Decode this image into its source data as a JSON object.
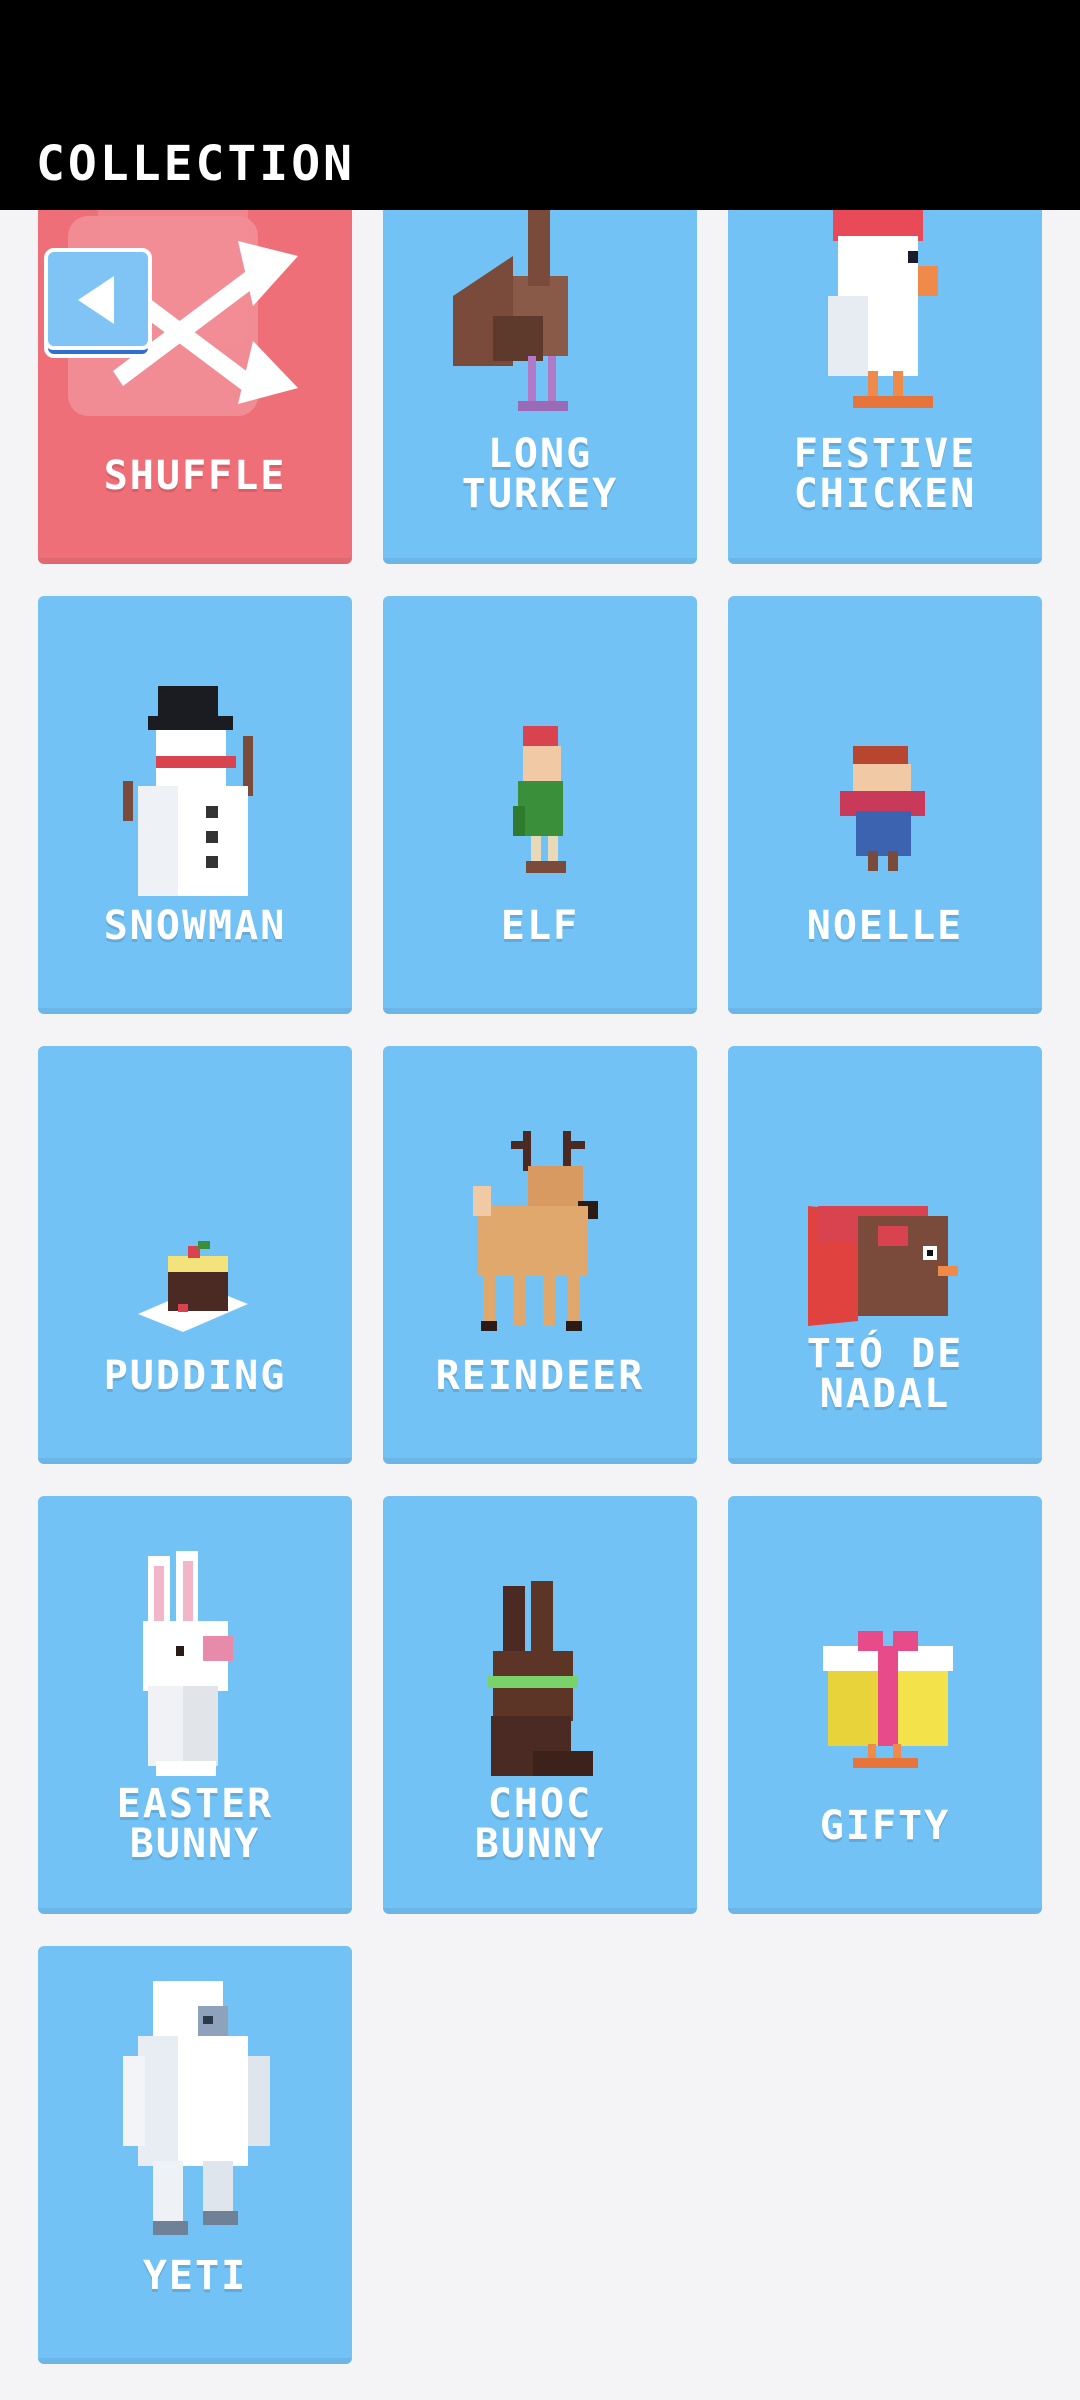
{
  "header": {
    "title": "COLLECTION"
  },
  "back_button": {
    "icon": "back-arrow-icon"
  },
  "colors": {
    "header_bg": "#000000",
    "card_blue": "#72c2f5",
    "card_shuffle": "#ef6f78",
    "page_bg": "#f4f4f6"
  },
  "cards": [
    {
      "label": "SHUFFLE",
      "icon": "shuffle-icon"
    },
    {
      "label": "LONG\nTURKEY",
      "icon": "turkey-icon"
    },
    {
      "label": "FESTIVE\nCHICKEN",
      "icon": "chicken-icon"
    },
    {
      "label": "SNOWMAN",
      "icon": "snowman-icon"
    },
    {
      "label": "ELF",
      "icon": "elf-icon"
    },
    {
      "label": "NOELLE",
      "icon": "noelle-icon"
    },
    {
      "label": "PUDDING",
      "icon": "pudding-icon"
    },
    {
      "label": "REINDEER",
      "icon": "reindeer-icon"
    },
    {
      "label": "TIÓ DE\nNADAL",
      "icon": "tio-de-nadal-icon"
    },
    {
      "label": "EASTER\nBUNNY",
      "icon": "easter-bunny-icon"
    },
    {
      "label": "CHOC\nBUNNY",
      "icon": "choc-bunny-icon"
    },
    {
      "label": "GIFTY",
      "icon": "gifty-icon"
    },
    {
      "label": "YETI",
      "icon": "yeti-icon"
    }
  ]
}
